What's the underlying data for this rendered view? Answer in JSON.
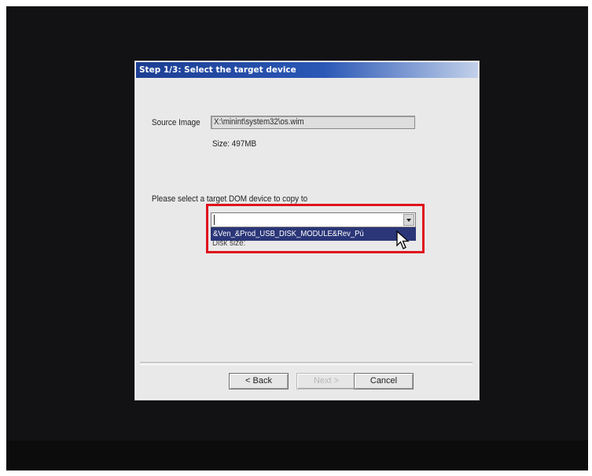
{
  "dialog": {
    "title": "Step 1/3: Select the target device",
    "source_image_label": "Source Image",
    "source_image_value": "X:\\minint\\system32\\os.wim",
    "size_label": "Size: 497MB",
    "select_prompt": "Please select a target DOM device to copy to",
    "device_combo_value": "",
    "dropdown_option": "&Ven_&Prod_USB_DISK_MODULE&Rev_Pú",
    "disk_size_label": "Disk size:"
  },
  "buttons": {
    "back": "< Back",
    "next": "Next >",
    "cancel": "Cancel"
  },
  "colors": {
    "title_bar": "#1c3e93",
    "dialog_bg": "#e9e9ea",
    "selected_option": "#2a3678",
    "annotation_box": "#e0121b"
  },
  "icons": {
    "pointer": "arrow-cursor-icon",
    "dropdown": "chevron-down-icon"
  }
}
